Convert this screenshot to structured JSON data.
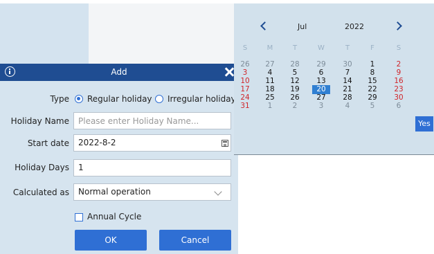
{
  "dialog": {
    "title": "Add",
    "type_label": "Type",
    "type_options": [
      {
        "label": "Regular holiday",
        "checked": true
      },
      {
        "label": "Irregular holiday",
        "checked": false
      }
    ],
    "name_label": "Holiday Name",
    "name_placeholder": "Please enter Holiday Name...",
    "name_value": "",
    "start_label": "Start date",
    "start_value": "2022-8-2",
    "days_label": "Holiday Days",
    "days_value": "1",
    "calc_label": "Calculated as",
    "calc_value": "Normal operation",
    "annual_label": "Annual Cycle",
    "annual_checked": false,
    "ok_label": "OK",
    "cancel_label": "Cancel"
  },
  "calendar": {
    "month": "Jul",
    "year": "2022",
    "weekdays": [
      "S",
      "M",
      "T",
      "W",
      "T",
      "F",
      "S"
    ],
    "weeks": [
      [
        {
          "d": "26",
          "o": true
        },
        {
          "d": "27",
          "o": true
        },
        {
          "d": "28",
          "o": true
        },
        {
          "d": "29",
          "o": true
        },
        {
          "d": "30",
          "o": true
        },
        {
          "d": "1"
        },
        {
          "d": "2",
          "w": true
        }
      ],
      [
        {
          "d": "3",
          "w": true
        },
        {
          "d": "4"
        },
        {
          "d": "5"
        },
        {
          "d": "6"
        },
        {
          "d": "7"
        },
        {
          "d": "8"
        },
        {
          "d": "9",
          "w": true
        }
      ],
      [
        {
          "d": "10",
          "w": true
        },
        {
          "d": "11"
        },
        {
          "d": "12"
        },
        {
          "d": "13"
        },
        {
          "d": "14"
        },
        {
          "d": "15"
        },
        {
          "d": "16",
          "w": true
        }
      ],
      [
        {
          "d": "17",
          "w": true
        },
        {
          "d": "18"
        },
        {
          "d": "19"
        },
        {
          "d": "20",
          "s": true
        },
        {
          "d": "21"
        },
        {
          "d": "22"
        },
        {
          "d": "23",
          "w": true
        }
      ],
      [
        {
          "d": "24",
          "w": true
        },
        {
          "d": "25"
        },
        {
          "d": "26"
        },
        {
          "d": "27"
        },
        {
          "d": "28"
        },
        {
          "d": "29"
        },
        {
          "d": "30",
          "w": true
        }
      ],
      [
        {
          "d": "31",
          "w": true
        },
        {
          "d": "1",
          "o": true
        },
        {
          "d": "2",
          "o": true
        },
        {
          "d": "3",
          "o": true
        },
        {
          "d": "4",
          "o": true
        },
        {
          "d": "5",
          "o": true
        },
        {
          "d": "6",
          "o": true
        }
      ]
    ],
    "yes_label": "Yes"
  },
  "colors": {
    "header": "#1f4d92",
    "accent": "#2f6fd4",
    "weekend": "#d0262b",
    "selected": "#2f7fd2",
    "dialog_bg": "#d6e4ef"
  }
}
